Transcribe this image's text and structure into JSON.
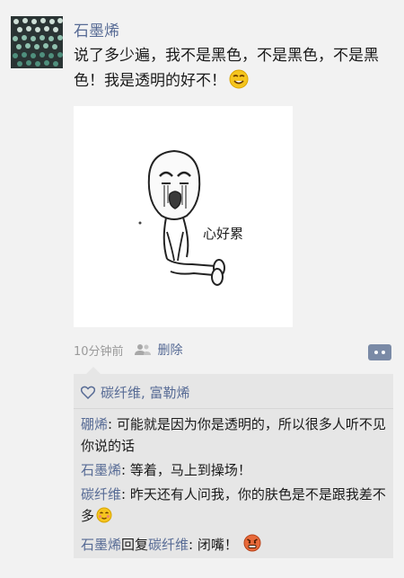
{
  "post": {
    "author": "石墨烯",
    "text": "说了多少遍，我不是黑色，不是黑色，不是黑色！我是透明的好不！",
    "image_caption": "心好累",
    "time": "10分钟前",
    "delete_label": "删除"
  },
  "likes": {
    "names": "碳纤维, 富勒烯"
  },
  "comments": [
    {
      "author": "硼烯",
      "separator": ": ",
      "text": "可能就是因为你是透明的，所以很多人听不见你说的话"
    },
    {
      "author": "石墨烯",
      "separator": ": ",
      "text": "等着，马上到操场！"
    },
    {
      "author": "碳纤维",
      "separator": ": ",
      "text": "昨天还有人问我，你的肤色是不是跟我差不多"
    },
    {
      "author": "石墨烯",
      "reply_word": "回复",
      "target": "碳纤维",
      "separator": ": ",
      "text": "闭嘴！"
    }
  ]
}
